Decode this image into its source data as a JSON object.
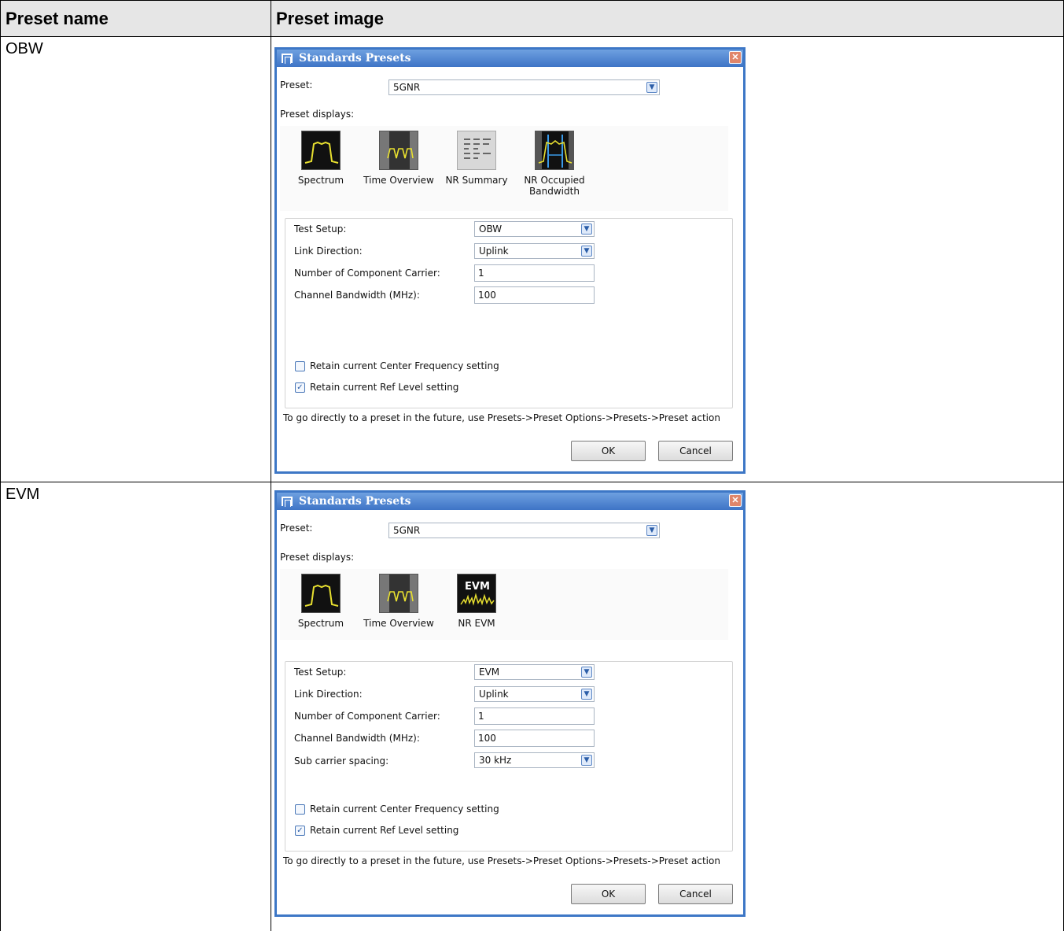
{
  "table": {
    "header_name": "Preset name",
    "header_image": "Preset image"
  },
  "rows": [
    {
      "name": "OBW",
      "dialog": {
        "title": "Standards Presets",
        "preset_label": "Preset:",
        "preset_value": "5GNR",
        "displays_label": "Preset displays:",
        "displays": [
          {
            "label": "Spectrum",
            "icon": "spectrum-icon"
          },
          {
            "label": "Time Overview",
            "icon": "time-overview-icon"
          },
          {
            "label": "NR Summary",
            "icon": "nr-summary-icon"
          },
          {
            "label": "NR Occupied Bandwidth",
            "icon": "nr-occupied-bandwidth-icon"
          }
        ],
        "test_setup_label": "Test Setup:",
        "test_setup_value": "OBW",
        "link_direction_label": "Link Direction:",
        "link_direction_value": "Uplink",
        "component_carrier_label": "Number of Component Carrier:",
        "component_carrier_value": "1",
        "channel_bw_label": "Channel Bandwidth (MHz):",
        "channel_bw_value": "100",
        "retain_cf_label": "Retain current Center Frequency setting",
        "retain_cf_checked": false,
        "retain_ref_label": "Retain current Ref Level setting",
        "retain_ref_checked": true,
        "hint": "To go directly to a preset in the future, use Presets->Preset Options->Presets->Preset action",
        "ok_label": "OK",
        "cancel_label": "Cancel"
      }
    },
    {
      "name": "EVM",
      "dialog": {
        "title": "Standards Presets",
        "preset_label": "Preset:",
        "preset_value": "5GNR",
        "displays_label": "Preset displays:",
        "displays": [
          {
            "label": "Spectrum",
            "icon": "spectrum-icon"
          },
          {
            "label": "Time Overview",
            "icon": "time-overview-icon"
          },
          {
            "label": "NR EVM",
            "icon": "nr-evm-icon",
            "icon_text": "EVM"
          }
        ],
        "test_setup_label": "Test Setup:",
        "test_setup_value": "EVM",
        "link_direction_label": "Link Direction:",
        "link_direction_value": "Uplink",
        "component_carrier_label": "Number of Component Carrier:",
        "component_carrier_value": "1",
        "channel_bw_label": "Channel Bandwidth (MHz):",
        "channel_bw_value": "100",
        "subcarrier_label": "Sub carrier spacing:",
        "subcarrier_value": "30 kHz",
        "retain_cf_label": "Retain current Center Frequency setting",
        "retain_cf_checked": false,
        "retain_ref_label": "Retain current Ref Level setting",
        "retain_ref_checked": true,
        "hint": "To go directly to a preset in the future, use Presets->Preset Options->Presets->Preset action",
        "ok_label": "OK",
        "cancel_label": "Cancel"
      }
    }
  ],
  "colors": {
    "title_bar": "#3e74c6",
    "signal_yellow": "#e8e030",
    "signal_blue": "#3a9ae8"
  }
}
